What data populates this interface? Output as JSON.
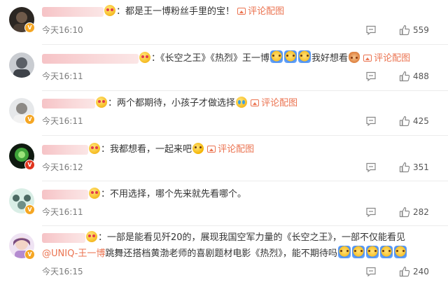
{
  "comments": [
    {
      "avatar_badge": "gold",
      "segments": [
        "：都是王一博粉丝手里的宝！"
      ],
      "link_label": "评论配图",
      "time": "今天16:10",
      "likes": "559"
    },
    {
      "avatar_badge": "gold",
      "segments": [
        "：《长空之王》《热烈》王一博",
        "我好想看"
      ],
      "link_label": "评论配图",
      "time": "今天16:11",
      "likes": "488"
    },
    {
      "avatar_badge": "gold",
      "segments": [
        "：两个都期待，小孩子才做选择"
      ],
      "link_label": "评论配图",
      "time": "今天16:11",
      "likes": "425"
    },
    {
      "avatar_badge": "red",
      "segments": [
        "：我都想看，一起来吧"
      ],
      "link_label": "评论配图",
      "time": "今天16:12",
      "likes": "351"
    },
    {
      "avatar_badge": "gold",
      "segments": [
        "：不用选择，哪个先来就先看哪个。"
      ],
      "link_label": "",
      "time": "今天16:11",
      "likes": "282"
    },
    {
      "avatar_badge": "gold",
      "segments": [
        "：一部是能看见歼20的，展现我国空军力量的《长空之王》，一部不仅能看见",
        "跳舞还搭档黄渤老师的喜剧题材电影《热烈》，能不期待吗"
      ],
      "mention": "@UNIQ-王一博",
      "time": "今天16:15",
      "likes": "240"
    }
  ],
  "icons": {
    "reply": "comment-icon",
    "like": "thumbs-up-icon",
    "verified": "verified-v-badge-icon",
    "attached_image": "picture-icon"
  },
  "colors": {
    "link": "#eb7350",
    "meta_text": "#7c7c7c",
    "badge_gold": "#f5a623",
    "badge_red": "#e0341e"
  }
}
